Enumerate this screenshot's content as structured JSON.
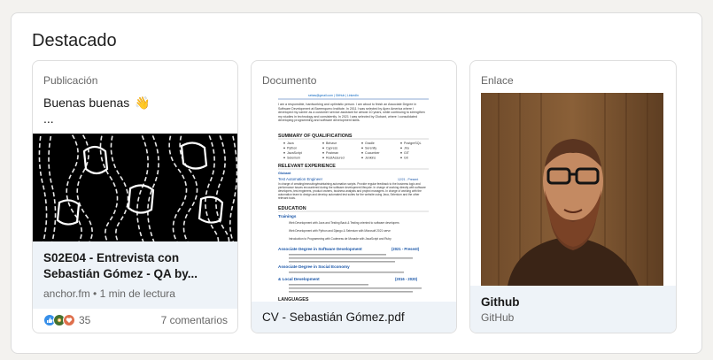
{
  "section": {
    "title": "Destacado"
  },
  "cards": {
    "post": {
      "type": "Publicación",
      "text": "Buenas buenas",
      "emoji": "👋",
      "ellipsis": "...",
      "link_title": "S02E04 - Entrevista con Sebastián Gómez - QA by...",
      "link_meta": "anchor.fm • 1 min de lectura",
      "reaction_count": "35",
      "comments": "7 comentarios",
      "reaction_icons": [
        "like-icon",
        "celebrate-icon",
        "love-icon"
      ]
    },
    "document": {
      "type": "Documento",
      "title": "CV - Sebastián Gómez.pdf",
      "preview": {
        "contact": "sebas@gmail.com  |  GitHub  |  LinkedIn",
        "summary": "I am a responsible, hardworking and optimistic person. I am about to finish an Associate Degree in Software Development at Barrenquero Institute. In 2011 I was selected by Apex America where I developed my career as a customer service assistant for almost 10 years, while continuing to strengthen my studies in technology and consistently. In 2021 I was selected by Globant, where I consolidated developing programming and software development skills.",
        "heading_qualifications": "SUMMARY OF QUALIFICATIONS",
        "skills": [
          "Java",
          "Python",
          "JavaScript",
          "Selenium",
          "Behave",
          "Cypress",
          "Postman",
          "RestAssured",
          "Gradle",
          "Serenity",
          "Cucumber",
          "Jenkins",
          "PostgreSQL",
          "Jira",
          "GIT",
          "Git"
        ],
        "heading_experience": "RELEVANT EXPERIENCE",
        "company": "Globant",
        "role": "Test Automation Engineer",
        "role_date": "12/21 - Present",
        "experience_text": "In charge of creating/executing/maintaining automation scripts. Provide regular feedback to the business logic and performance issues encountered during the software development lifecycle. In charge of working directly with software developers, test engineers, product owners, business analysts and project managers. In charge of working with the automation team to design and develop automated test suites for the website using Java, Selenium and the other relevant tools.",
        "heading_education": "EDUCATION",
        "trainings": "Trainings",
        "training_items": [
          "Web Development with Java and Testing Back & Testing oriented to software developers",
          "Web Development with Python and Django & Selenium with Microsoft 2021 serve",
          "Introduction to Programming with Codeness de Monade with JavaScript and Ruby"
        ],
        "degree1": "Associate Degree in Software Development",
        "degree1_date": "(2021 - Present)",
        "degree2": "Associate Degree in Social Economy",
        "degree3": "& Local Development",
        "degree3_date": "(2016 - 2020)",
        "heading_languages": "LANGUAGES"
      }
    },
    "link": {
      "type": "Enlace",
      "title": "Github",
      "subtitle": "GitHub"
    }
  },
  "colors": {
    "page_bg": "#f3f2ef",
    "card_footer_bg": "#eef3f8",
    "doc_heading": "#1a56a8",
    "link_blue": "#0a66c2",
    "like": "#378fe9",
    "celebrate": "#44712e",
    "love": "#df704d"
  }
}
